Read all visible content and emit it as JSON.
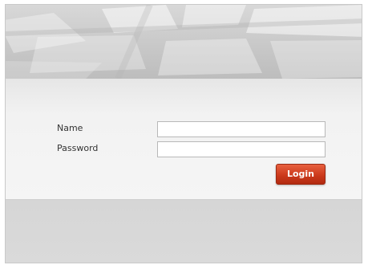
{
  "form": {
    "name_label": "Name",
    "password_label": "Password",
    "name_value": "",
    "password_value": "",
    "login_label": "Login"
  },
  "colors": {
    "login_button": "#cc3a1c",
    "background": "#d9d9d9",
    "form_panel": "#f2f2f2"
  }
}
